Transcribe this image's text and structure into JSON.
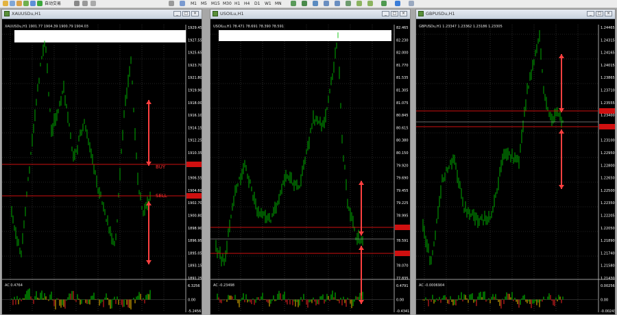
{
  "toolbar": {
    "auto_trading_label": "自动交易",
    "timeframes": [
      "M1",
      "M5",
      "M15",
      "M30",
      "H1",
      "H4",
      "D1",
      "W1",
      "MN"
    ]
  },
  "windows": [
    {
      "title": "XAUUSDu,H1",
      "header": "XAUUSDu,H1  1901.77 1904.39 1900.79 1904.03",
      "price_labels": [
        "1929.45",
        "1927.55",
        "1925.65",
        "1923.70",
        "1921.80",
        "1919.90",
        "1918.00",
        "1916.10",
        "1914.15",
        "1912.25",
        "1910.35",
        "1908.45",
        "1906.55",
        "1904.60",
        "1902.70",
        "1900.80",
        "1898.90",
        "1896.95",
        "1895.05",
        "1893.15",
        "1891.25"
      ],
      "ind_header": "AC 0.4764",
      "ind_labels": [
        "6.3256",
        "0.00",
        "-5.2456"
      ],
      "annotations": [
        "BUY",
        "SELL"
      ]
    },
    {
      "title": "USOILu,H1",
      "header": "USOILu,H1  78.471 78.691 78.390 78.591",
      "price_labels": [
        "82.465",
        "82.230",
        "82.000",
        "81.770",
        "81.535",
        "81.305",
        "81.075",
        "80.845",
        "80.615",
        "80.380",
        "80.150",
        "79.920",
        "79.690",
        "79.455",
        "79.225",
        "78.995",
        "78.765",
        "78.591",
        "78.300",
        "78.070",
        "77.835"
      ],
      "ind_header": "AC -0.23498",
      "ind_labels": [
        "0.4791",
        "0.00",
        "-0.4341"
      ],
      "annotations": []
    },
    {
      "title": "GBPUSDu,H1",
      "header": "GBPUSDu,H1  1.23347 1.23362 1.23186 1.23305",
      "price_labels": [
        "1.24465",
        "1.24315",
        "1.24165",
        "1.24015",
        "1.23865",
        "1.23710",
        "1.23555",
        "1.23400",
        "1.23305",
        "1.23100",
        "1.22950",
        "1.22800",
        "1.22650",
        "1.22500",
        "1.22350",
        "1.22205",
        "1.22050",
        "1.21890",
        "1.21740",
        "1.21580",
        "1.21430"
      ],
      "ind_header": "AC -0.0006904",
      "ind_labels": [
        "0.0025604",
        "0.00",
        "-0.0024304"
      ],
      "annotations": []
    }
  ],
  "colors": {
    "background": "#000000",
    "bars": "#00c000",
    "grid": "#4a4a4a",
    "levels": "#ff2020",
    "arrows": "#ff4040",
    "axis_text": "#ffffff",
    "marker_price": "#d01010"
  }
}
